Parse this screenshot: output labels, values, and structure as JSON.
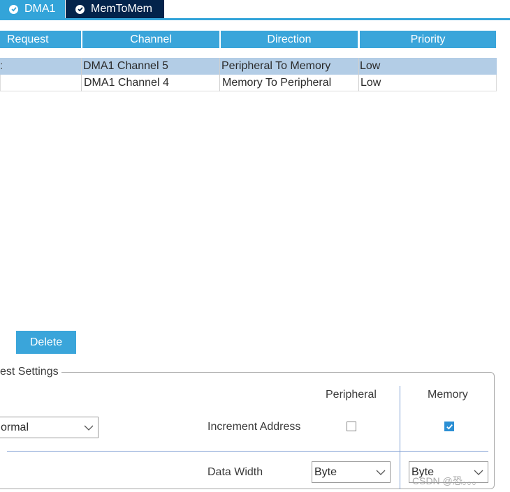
{
  "tabs": [
    {
      "label": "DMA1",
      "active": true
    },
    {
      "label": "MemToMem",
      "active": false
    }
  ],
  "table": {
    "columns": [
      "Request",
      "Channel",
      "Direction",
      "Priority"
    ],
    "rows": [
      {
        "request": "",
        "channel": "DMA1 Channel 5",
        "direction": "Peripheral To Memory",
        "priority": "Low",
        "selected": true
      },
      {
        "request": "",
        "channel": "DMA1 Channel 4",
        "direction": "Memory To Peripheral",
        "priority": "Low",
        "selected": false
      }
    ]
  },
  "buttons": {
    "delete": "Delete"
  },
  "settings": {
    "group_title": "est Settings",
    "mode_value": "ormal",
    "col_peripheral": "Peripheral",
    "col_memory": "Memory",
    "increment_label": "Increment Address",
    "increment_peripheral_checked": false,
    "increment_memory_checked": true,
    "data_width_label": "Data Width",
    "data_width_peripheral": "Byte",
    "data_width_memory": "Byte"
  },
  "watermark": "CSDN @恐。。。",
  "colors": {
    "tab_active": "#33a4d9",
    "tab_inactive": "#03234b",
    "header": "#3aa5da",
    "selected_row": "#b3cde6",
    "check_blue": "#2b8fd4"
  }
}
